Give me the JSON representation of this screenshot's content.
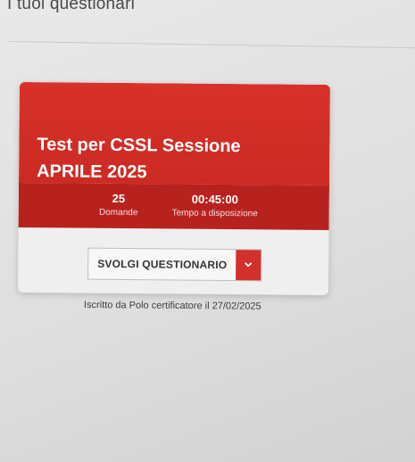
{
  "page": {
    "heading": "I tuoi questionari"
  },
  "card": {
    "title": "Test per CSSL Sessione APRILE 2025",
    "stats": {
      "questions_value": "25",
      "questions_label": "Domande",
      "time_value": "00:45:00",
      "time_label": "Tempo a disposizione"
    },
    "actions": {
      "start_label": "SVOLGI QUESTIONARIO",
      "dropdown_icon": "chevron-down-icon"
    }
  },
  "enrollment_caption": "Iscritto da Polo certificatore il 27/02/2025",
  "colors": {
    "header_red": "#d8312b",
    "stats_red": "#b8221e",
    "dropdown_red": "#d2302a"
  }
}
